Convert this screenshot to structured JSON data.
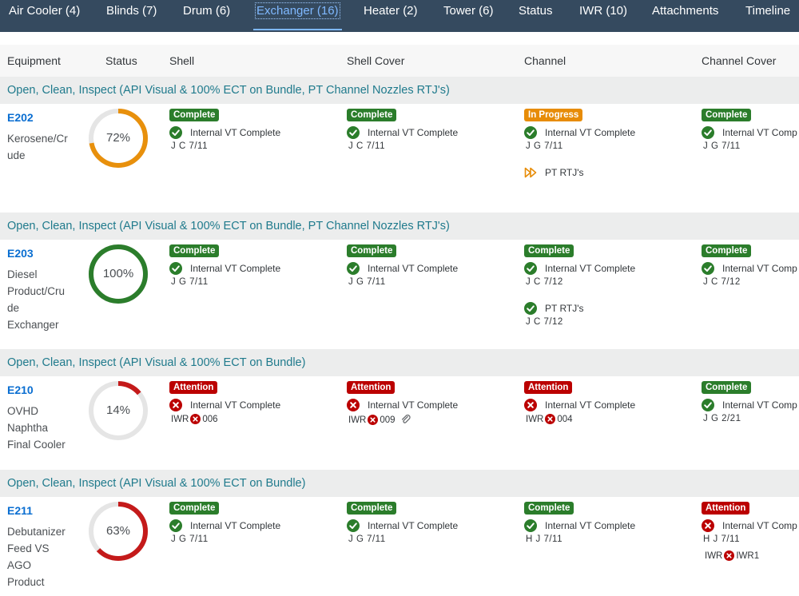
{
  "nav": {
    "tabs": [
      {
        "label": "Air Cooler (4)"
      },
      {
        "label": "Blinds (7)"
      },
      {
        "label": "Drum (6)"
      },
      {
        "label": "Exchanger (16)",
        "active": true
      },
      {
        "label": "Heater (2)"
      },
      {
        "label": "Tower (6)"
      },
      {
        "label": "Status"
      },
      {
        "label": "IWR (10)"
      },
      {
        "label": "Attachments"
      },
      {
        "label": "Timeline"
      }
    ]
  },
  "columns": {
    "equipment": "Equipment",
    "status": "Status",
    "shell": "Shell",
    "shell_cover": "Shell Cover",
    "channel": "Channel",
    "channel_cover": "Channel Cover"
  },
  "colors": {
    "complete": "#2b7d2b",
    "in_progress": "#e78c07",
    "attention": "#bb0000",
    "ring_track": "#e5e5e5"
  },
  "groups": [
    {
      "title": "Open, Clean, Inspect (API Visual & 100% ECT on Bundle, PT Channel Nozzles RTJ's)",
      "id": "E202",
      "desc": [
        "Kerosene/Cr",
        "ude"
      ],
      "pct_label": "72%",
      "progress": 0.72,
      "ring_color": "#e8900c",
      "cells": [
        {
          "badge": "Complete",
          "state": "complete",
          "items": [
            {
              "icon": "check-circle-icon",
              "text": "Internal VT Complete",
              "sub": "J C  7/11"
            }
          ]
        },
        {
          "badge": "Complete",
          "state": "complete",
          "items": [
            {
              "icon": "check-circle-icon",
              "text": "Internal VT Complete",
              "sub": "J C  7/11"
            }
          ]
        },
        {
          "badge": "In Progress",
          "state": "progress",
          "items": [
            {
              "icon": "check-circle-icon",
              "text": "Internal VT Complete",
              "sub": "J G  7/11"
            },
            {
              "icon": "fast-forward-icon",
              "text": "PT RTJ's",
              "sub": ""
            }
          ]
        },
        {
          "badge": "Complete",
          "state": "complete",
          "items": [
            {
              "icon": "check-circle-icon",
              "text": "Internal VT Comp",
              "sub": "J G  7/11"
            }
          ]
        }
      ]
    },
    {
      "title": "Open, Clean, Inspect (API Visual & 100% ECT on Bundle, PT Channel Nozzles RTJ's)",
      "id": "E203",
      "desc": [
        "Diesel",
        "Product/Cru",
        "de",
        "Exchanger"
      ],
      "pct_label": "100%",
      "progress": 1.0,
      "ring_color": "#2b7d2b",
      "cells": [
        {
          "badge": "Complete",
          "state": "complete",
          "items": [
            {
              "icon": "check-circle-icon",
              "text": "Internal VT Complete",
              "sub": "J G  7/11"
            }
          ]
        },
        {
          "badge": "Complete",
          "state": "complete",
          "items": [
            {
              "icon": "check-circle-icon",
              "text": "Internal VT Complete",
              "sub": "J G  7/11"
            }
          ]
        },
        {
          "badge": "Complete",
          "state": "complete",
          "items": [
            {
              "icon": "check-circle-icon",
              "text": "Internal VT Complete",
              "sub": "J C  7/12"
            },
            {
              "icon": "check-circle-icon",
              "text": "PT RTJ's",
              "sub": "J C  7/12"
            }
          ]
        },
        {
          "badge": "Complete",
          "state": "complete",
          "items": [
            {
              "icon": "check-circle-icon",
              "text": "Internal VT Comp",
              "sub": "J C  7/12"
            }
          ]
        }
      ]
    },
    {
      "title": "Open, Clean, Inspect (API Visual & 100% ECT on Bundle)",
      "id": "E210",
      "desc": [
        "OVHD",
        "Naphtha",
        "Final Cooler"
      ],
      "pct_label": "14%",
      "progress": 0.14,
      "ring_color": "#c41a1a",
      "cells": [
        {
          "badge": "Attention",
          "state": "attention",
          "items": [
            {
              "icon": "error-circle-icon",
              "text": "Internal VT Complete",
              "iwr": "006"
            }
          ]
        },
        {
          "badge": "Attention",
          "state": "attention",
          "items": [
            {
              "icon": "error-circle-icon",
              "text": "Internal VT Complete",
              "iwr": "009",
              "attach": true
            }
          ]
        },
        {
          "badge": "Attention",
          "state": "attention",
          "items": [
            {
              "icon": "error-circle-icon",
              "text": "Internal VT Complete",
              "iwr": "004"
            }
          ]
        },
        {
          "badge": "Complete",
          "state": "complete",
          "items": [
            {
              "icon": "check-circle-icon",
              "text": "Internal VT Comp",
              "sub": "J G  2/21"
            }
          ]
        }
      ]
    },
    {
      "title": "Open, Clean, Inspect (API Visual & 100% ECT on Bundle)",
      "id": "E211",
      "desc": [
        "Debutanizer",
        "Feed VS",
        "AGO",
        "Product"
      ],
      "pct_label": "63%",
      "progress": 0.63,
      "ring_color": "#c41a1a",
      "cells": [
        {
          "badge": "Complete",
          "state": "complete",
          "items": [
            {
              "icon": "check-circle-icon",
              "text": "Internal VT Complete",
              "sub": "J G  7/11"
            }
          ]
        },
        {
          "badge": "Complete",
          "state": "complete",
          "items": [
            {
              "icon": "check-circle-icon",
              "text": "Internal VT Complete",
              "sub": "J G  7/11"
            }
          ]
        },
        {
          "badge": "Complete",
          "state": "complete",
          "items": [
            {
              "icon": "check-circle-icon",
              "text": "Internal VT Complete",
              "sub": "H J  7/11"
            }
          ]
        },
        {
          "badge": "Attention",
          "state": "attention",
          "items": [
            {
              "icon": "error-circle-icon",
              "text": "Internal VT Comp",
              "sub": "H J  7/11",
              "iwr": "IWR1"
            }
          ]
        }
      ]
    }
  ],
  "labels": {
    "iwr_prefix": "IWR"
  }
}
